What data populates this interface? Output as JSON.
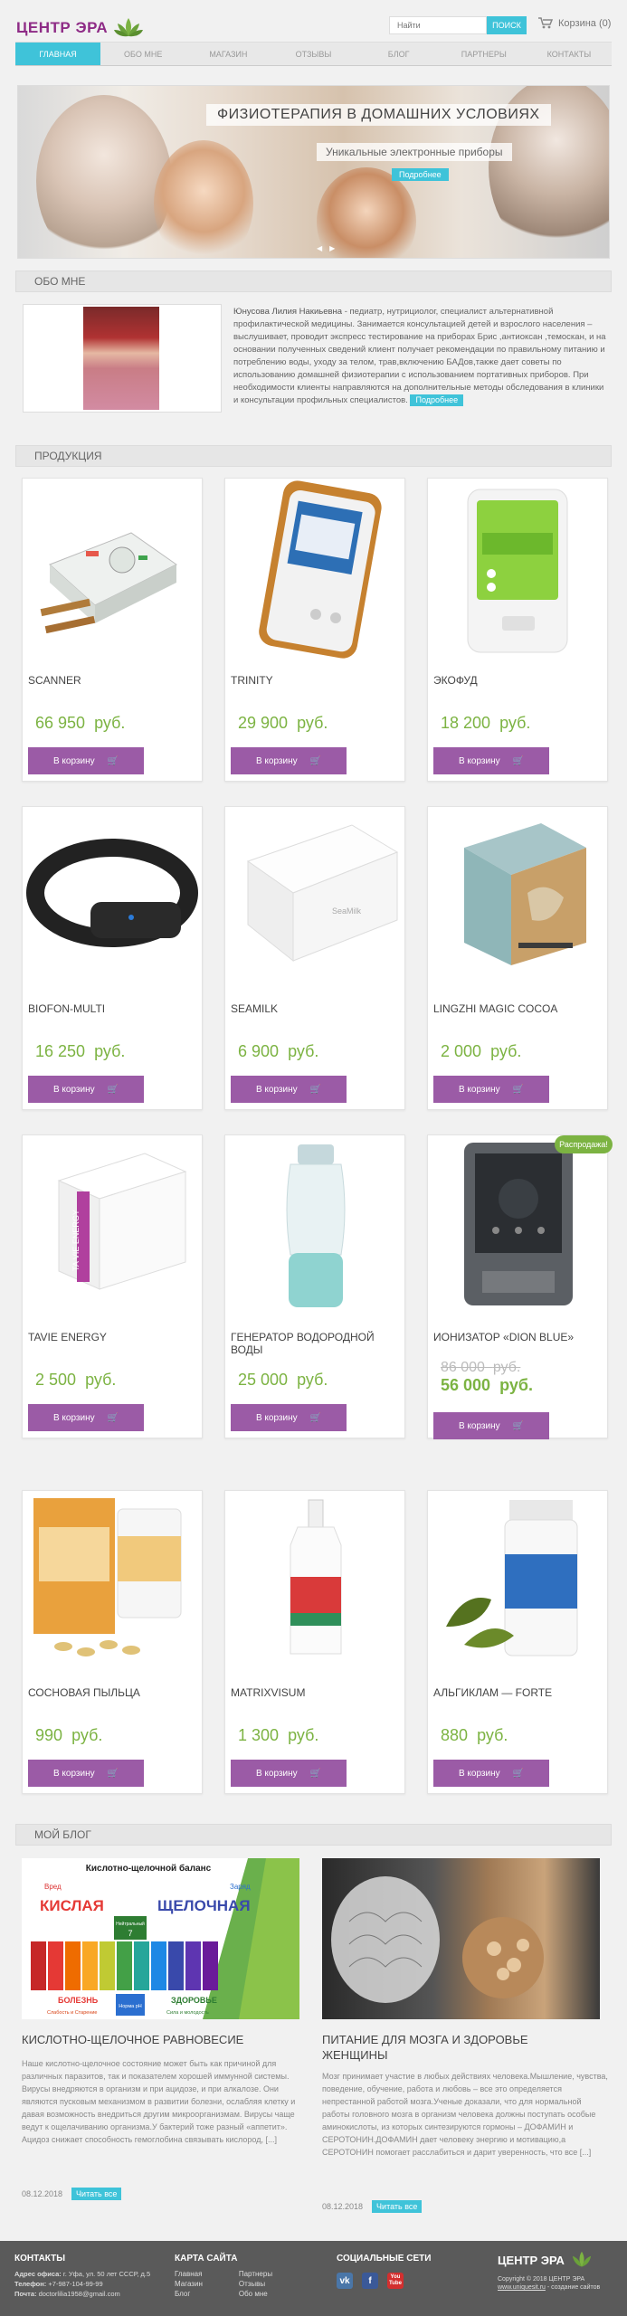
{
  "header": {
    "logo_text": "ЦЕНТР ЭРА",
    "search_placeholder": "Найти",
    "search_button": "ПОИСК",
    "cart_label": "Корзина (0)"
  },
  "nav": {
    "items": [
      "ГЛАВНАЯ",
      "ОБО МНЕ",
      "МАГАЗИН",
      "ОТЗЫВЫ",
      "БЛОГ",
      "ПАРТНЕРЫ",
      "КОНТАКТЫ"
    ],
    "active_index": 0
  },
  "slider": {
    "title": "ФИЗИОТЕРАПИЯ В ДОМАШНИХ УСЛОВИЯХ",
    "subtitle": "Уникальные электронные приборы",
    "button": "Подробнее",
    "prev": "◀",
    "next": "▶"
  },
  "about": {
    "section_title": "ОБО МНЕ",
    "name": "Юнусова Лилия Накиьевна",
    "text": " - педиатр, нутрициолог, специалист альтернативной профилактической медицины. Занимается консультацией детей и взрослого населения – выслушивает, проводит экспресс тестирование на приборах Брис ,антиоксан ,темоскан, и на основании полученных сведений клиент получает рекомендации по правильному питанию и потреблению воды, уходу за телом, трав,включению БАДов,также дает советы по использованию домашней физиотерапии с использованием портативных приборов. При необходимости клиенты направляются на дополнительные методы обследования в клиники и консультации профильных специалистов.",
    "more_button": "Подробнее"
  },
  "products": {
    "section_title": "ПРОДУКЦИЯ",
    "button_label": "В корзину",
    "currency": "руб.",
    "sale_label": "Распродажа!",
    "items": [
      {
        "name": "SCANNER",
        "price": "66 950"
      },
      {
        "name": "TRINITY",
        "price": "29 900"
      },
      {
        "name": "ЭКОФУД",
        "price": "18 200"
      },
      {
        "name": "BIOFON-MULTI",
        "price": "16 250"
      },
      {
        "name": "SEAMILK",
        "price": "6 900"
      },
      {
        "name": "LINGZHI MAGIC COCOA",
        "price": "2 000"
      },
      {
        "name": "TAVIE ENERGY",
        "price": "2 500"
      },
      {
        "name": "ГЕНЕРАТОР ВОДОРОДНОЙ ВОДЫ",
        "price": "25 000"
      },
      {
        "name": "ИОНИЗАТОР «DION BLUE»",
        "old_price": "86 000",
        "price": "56 000"
      },
      {
        "name": "СОСНОВАЯ ПЫЛЬЦА",
        "price": "990"
      },
      {
        "name": "MATRIXVISUM",
        "price": "1 300"
      },
      {
        "name": "АЛЬГИКЛАМ — FORTE",
        "price": "880"
      }
    ]
  },
  "blog": {
    "section_title": "МОЙ БЛОГ",
    "read_more": "Читать все",
    "posts": [
      {
        "title": "КИСЛОТНО-ЩЕЛОЧНОЕ РАВНОВЕСИЕ",
        "text": "Наше кислотно-щелочное состояние может быть как причиной для различных паразитов, так и показателем хорошей иммунной системы. Вирусы внедряются в организм и при ацидозе, и при алкалозе. Они являются пусковым механизмом в развитии болезни, ослабляя клетку и давая возможность внедриться другим микроорганизмам. Вирусы чаще ведут к ощелачиванию организма.У бактерий тоже разный «аппетит». Ацидоз снижает способность гемоглобина связывать кислород, [...]",
        "date": "08.12.2018",
        "chart": {
          "heading": "Кислотно-щелочной баланс",
          "acid": "КИСЛАЯ",
          "alkaline": "ЩЕЛОЧНАЯ",
          "acid_tag": "Вред",
          "alkaline_tag": "Заряд",
          "neutral": "7",
          "neutral_label": "Нейтральный",
          "disease": "БОЛЕЗНЬ",
          "health": "ЗДОРОВЬЕ",
          "disease_note": "Слабость и Старение",
          "norm_label": "Норма pH",
          "health_note": "Сила и молодость"
        }
      },
      {
        "title": "ПИТАНИЕ ДЛЯ МОЗГА И ЗДОРОВЬЕ ЖЕНЩИНЫ",
        "text": "Мозг принимает участие в любых действиях человека.Мышление, чувства, поведение, обучение, работа и любовь – все это определяется непрестанной работой мозга.Ученые доказали, что для нормальной работы головного мозга в организм человека должны поступать особые аминокислоты, из которых синтезируются гормоны – ДОФАМИН и СЕРОТОНИН.ДОФАМИН дает человеку энергию и мотивацию,а СЕРОТОНИН помогает расслабиться и дарит уверенность, что все [...]",
        "date": "08.12.2018"
      }
    ]
  },
  "footer": {
    "contacts_title": "КОНТАКТЫ",
    "address_label": "Адрес офиса:",
    "address": "г. Уфа, ул. 50 лет СССР, д.5",
    "phone_label": "Телефон:",
    "phone": "+7-987-104-99-99",
    "email_label": "Почта:",
    "email": "doctorlilia1958@gmail.com",
    "sitemap_title": "КАРТА САЙТА",
    "sitemap_col1": [
      "Главная",
      "Магазин",
      "Блог"
    ],
    "sitemap_col2": [
      "Партнеры",
      "Отзывы",
      "Обо мне"
    ],
    "social_title": "СОЦИАЛЬНЫЕ СЕТИ",
    "social": [
      "vk",
      "f",
      "You Tube"
    ],
    "copyright": "Copyright © 2018 ЦЕНТР ЭРА",
    "dev_site": "www.uniquesit.ru",
    "dev_text": " - создание сайтов",
    "logo_text": "ЦЕНТР ЭРА"
  },
  "colors": {
    "accent": "#3fc3d9",
    "brand": "#8e2b86",
    "button": "#9b5ba6",
    "price": "#7cb342",
    "footer_bg": "#5a5a5a"
  }
}
